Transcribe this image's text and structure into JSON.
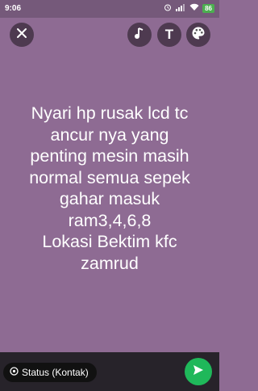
{
  "statusbar": {
    "time": "9:06",
    "battery": "86",
    "alarm_icon": "alarm-icon",
    "signal_icon": "signal-icon",
    "wifi_icon": "wifi-icon"
  },
  "toolbar": {
    "close_icon": "close-icon",
    "music_icon": "music-note-icon",
    "text_label": "T",
    "palette_icon": "palette-icon"
  },
  "message": {
    "lines": [
      "Nyari hp rusak lcd tc",
      "ancur nya yang",
      "penting mesin masih",
      "normal semua sepek",
      "gahar masuk",
      "ram3,4,6,8",
      "Lokasi Bektim kfc",
      "zamrud"
    ]
  },
  "footer": {
    "status_label": "Status (Kontak)",
    "send_icon": "send-icon"
  },
  "colors": {
    "background": "#8e6b93",
    "send": "#1fb85a"
  }
}
